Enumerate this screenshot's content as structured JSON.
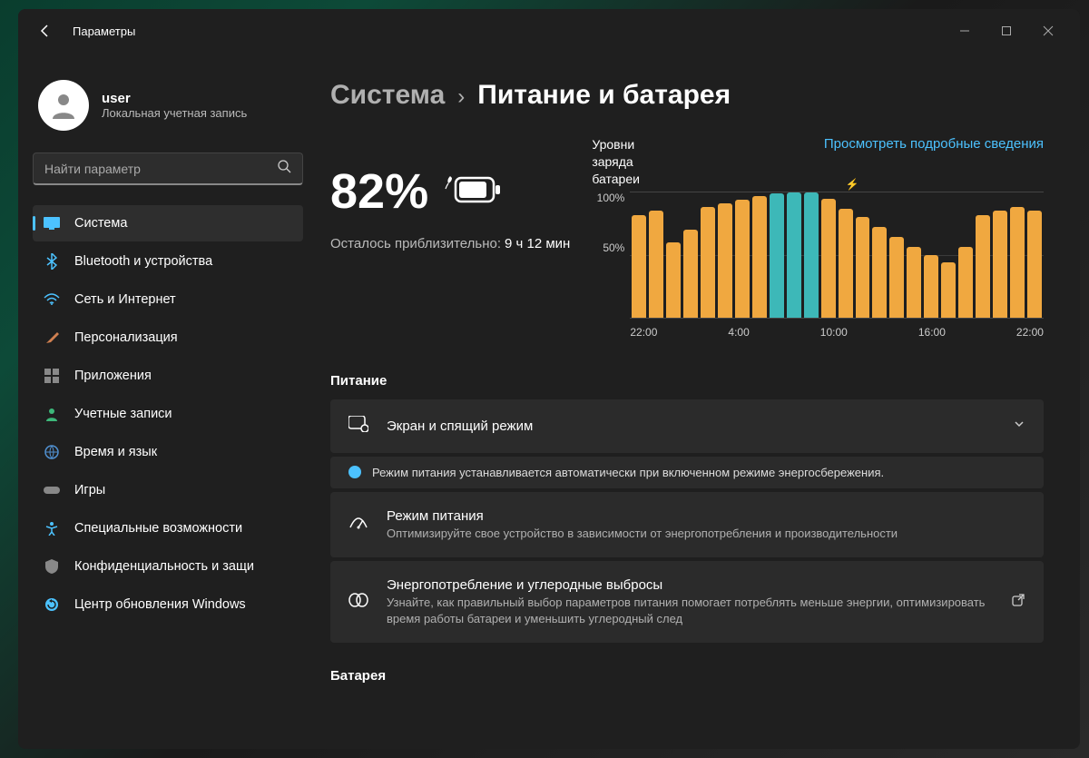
{
  "titlebar": {
    "title": "Параметры"
  },
  "user": {
    "name": "user",
    "subtitle": "Локальная учетная запись"
  },
  "search": {
    "placeholder": "Найти параметр"
  },
  "nav": {
    "items": [
      {
        "label": "Система",
        "active": true
      },
      {
        "label": "Bluetooth и устройства"
      },
      {
        "label": "Сеть и Интернет"
      },
      {
        "label": "Персонализация"
      },
      {
        "label": "Приложения"
      },
      {
        "label": "Учетные записи"
      },
      {
        "label": "Время и язык"
      },
      {
        "label": "Игры"
      },
      {
        "label": "Специальные возможности"
      },
      {
        "label": "Конфиденциальность и защи"
      },
      {
        "label": "Центр обновления Windows"
      }
    ]
  },
  "breadcrumb": {
    "parent": "Система",
    "current": "Питание и батарея"
  },
  "battery": {
    "percent": "82%",
    "remaining_label": "Осталось приблизительно:",
    "remaining_value": "9 ч 12 мин"
  },
  "chart": {
    "title": "Уровни заряда батареи",
    "link": "Просмотреть подробные сведения",
    "y100": "100%",
    "y50": "50%",
    "xlabels": [
      "22:00",
      "4:00",
      "10:00",
      "16:00",
      "22:00"
    ]
  },
  "chart_data": {
    "type": "bar",
    "title": "Уровни заряда батареи",
    "ylabel": "%",
    "ylim": [
      0,
      100
    ],
    "x_ticks": [
      "22:00",
      "4:00",
      "10:00",
      "16:00",
      "22:00"
    ],
    "series": [
      {
        "name": "battery_level",
        "values": [
          82,
          85,
          60,
          70,
          88,
          91,
          94,
          97,
          99,
          100,
          100,
          95,
          87,
          80,
          72,
          64,
          56,
          50,
          44,
          56,
          82,
          85,
          88,
          85
        ],
        "colors": [
          "orange",
          "orange",
          "orange",
          "orange",
          "orange",
          "orange",
          "orange",
          "orange",
          "teal",
          "teal",
          "teal",
          "orange",
          "orange",
          "orange",
          "orange",
          "orange",
          "orange",
          "orange",
          "orange",
          "orange",
          "orange",
          "orange",
          "orange",
          "orange"
        ]
      }
    ],
    "annotations": [
      {
        "type": "bolt",
        "bar_index": 12
      }
    ]
  },
  "sections": {
    "power_title": "Питание",
    "battery_title": "Батарея",
    "row_screen": {
      "label": "Экран и спящий режим"
    },
    "info_banner": "Режим питания устанавливается автоматически при включенном режиме энергосбережения.",
    "row_power_mode": {
      "label": "Режим питания",
      "sub": "Оптимизируйте свое устройство в зависимости от энергопотребления и производительности"
    },
    "row_energy": {
      "label": "Энергопотребление и углеродные выбросы",
      "sub": "Узнайте, как правильный выбор параметров питания помогает потреблять меньше энергии, оптимизировать время работы батареи и уменьшить углеродный след"
    }
  }
}
